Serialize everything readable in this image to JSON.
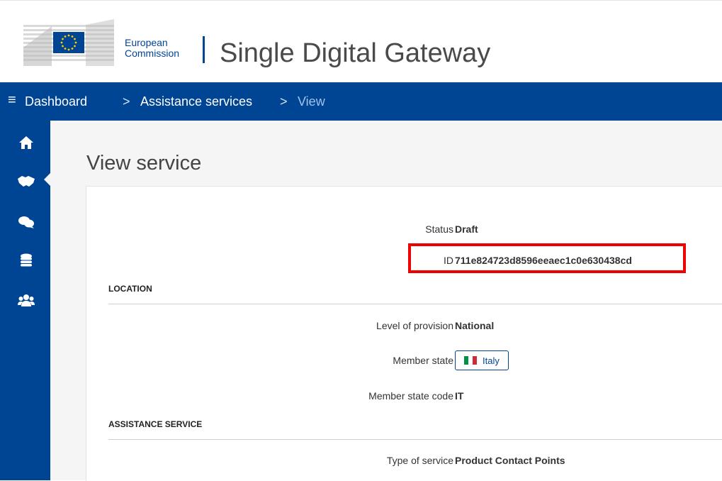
{
  "header": {
    "org_line1": "European",
    "org_line2": "Commission",
    "site_title": "Single Digital Gateway"
  },
  "breadcrumb": {
    "dashboard": "Dashboard",
    "assistance_services": "Assistance services",
    "view": "View",
    "separator": ">"
  },
  "sidebar": {
    "items": [
      {
        "icon": "home-icon"
      },
      {
        "icon": "handshake-icon",
        "active": true
      },
      {
        "icon": "comments-icon"
      },
      {
        "icon": "coins-icon"
      },
      {
        "icon": "users-icon"
      }
    ]
  },
  "page": {
    "title": "View service"
  },
  "fields": {
    "status_label": "Status",
    "status_value": "Draft",
    "id_label": "ID",
    "id_value": "711e824723d8596eeaec1c0e630438cd",
    "level_label": "Level of provision",
    "level_value": "National",
    "member_state_label": "Member state",
    "member_state_value": "Italy",
    "member_state_code_label": "Member state code",
    "member_state_code_value": "IT",
    "type_label": "Type of service",
    "type_value": "Product Contact Points"
  },
  "sections": {
    "location": "LOCATION",
    "assistance_service": "ASSISTANCE SERVICE"
  },
  "colors": {
    "brand_blue": "#004494",
    "highlight_red": "#ee0000",
    "eu_yellow": "#ffcc00",
    "flag_green": "#009246",
    "flag_white": "#ffffff",
    "flag_red": "#ce2b37"
  }
}
